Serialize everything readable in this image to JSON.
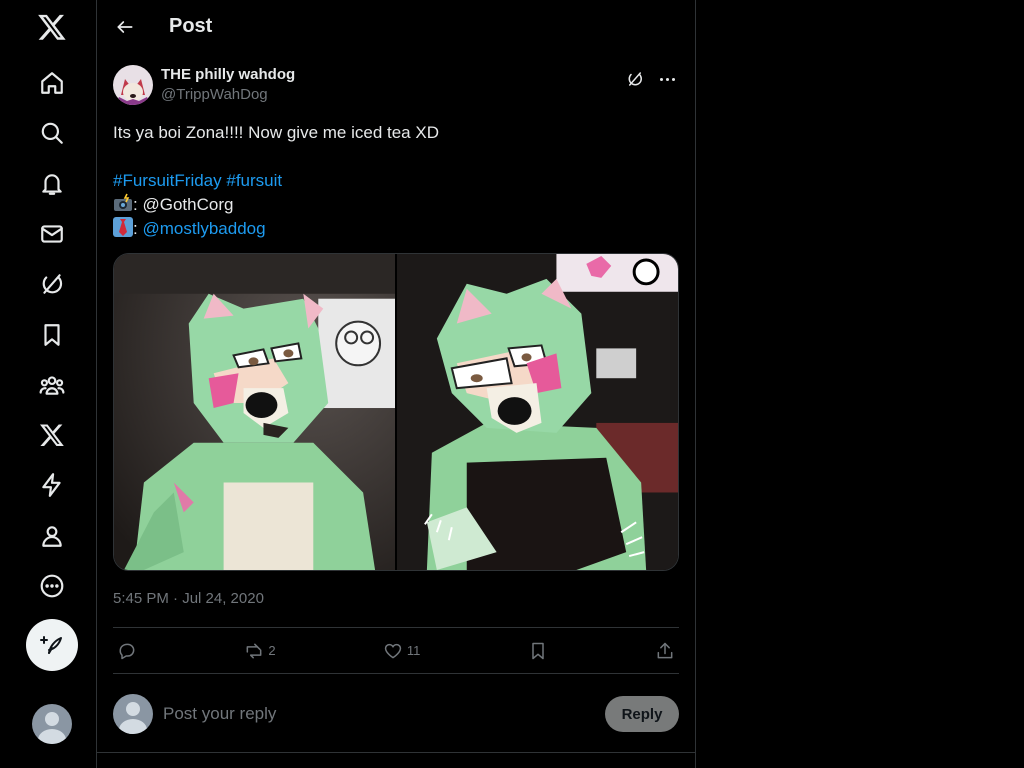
{
  "header": {
    "title": "Post",
    "back_icon": "arrow-left-icon"
  },
  "nav": {
    "items": [
      {
        "icon": "x-logo-icon"
      },
      {
        "icon": "home-icon"
      },
      {
        "icon": "search-icon"
      },
      {
        "icon": "bell-icon"
      },
      {
        "icon": "mail-icon"
      },
      {
        "icon": "grok-icon"
      },
      {
        "icon": "bookmark-icon"
      },
      {
        "icon": "communities-icon"
      },
      {
        "icon": "premium-x-icon"
      },
      {
        "icon": "lightning-icon"
      },
      {
        "icon": "profile-icon"
      },
      {
        "icon": "more-circle-icon"
      }
    ],
    "compose_icon": "feather-plus-icon",
    "account_icon": "default-avatar-icon"
  },
  "post": {
    "author": {
      "display_name": "THE philly wahdog",
      "handle": "@TrippWahDog"
    },
    "text_line1": "Its ya boi Zona!!!! Now give me iced tea XD",
    "hashtags": [
      "#FursuitFriday",
      "#fursuit"
    ],
    "credits": [
      {
        "emoji": "camera-flash-emoji",
        "separator": ":",
        "text": "@GothCorg",
        "is_link": false
      },
      {
        "emoji": "necktie-emoji",
        "separator": ":",
        "text": "@mostlybaddog",
        "is_link": true
      }
    ],
    "timestamp": "5:45 PM · Jul 24, 2020",
    "stats": {
      "retweets": "2",
      "likes": "11"
    }
  },
  "reply": {
    "placeholder": "Post your reply",
    "button_label": "Reply"
  },
  "colors": {
    "background": "#000000",
    "text": "#e7e9ea",
    "muted": "#71767b",
    "link": "#1d9bf0",
    "border": "#2f3336",
    "reply_button": "#787a7a"
  }
}
